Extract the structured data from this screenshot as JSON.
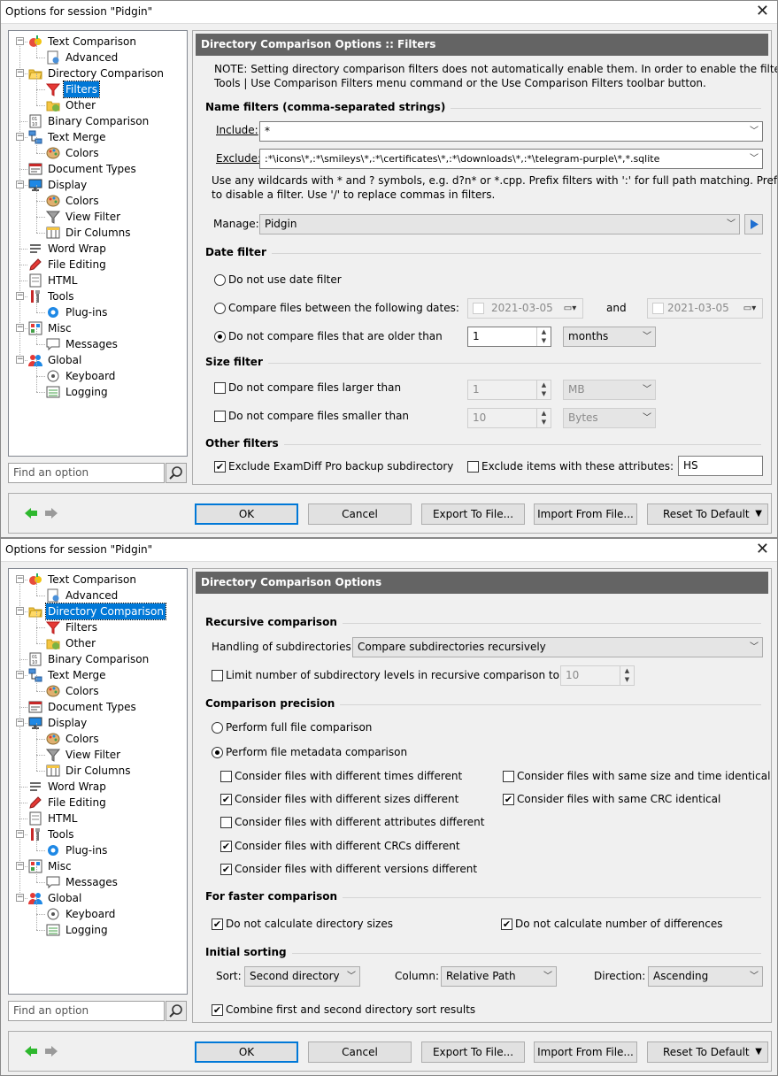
{
  "dialog1": {
    "title": "Options for session \"Pidgin\"",
    "tree": [
      {
        "label": "Text Comparison",
        "level": 0,
        "icon": "text-comparison-icon"
      },
      {
        "label": "Advanced",
        "level": 1,
        "icon": "advanced-icon"
      },
      {
        "label": "Directory Comparison",
        "level": 0,
        "icon": "folder-icon"
      },
      {
        "label": "Filters",
        "level": 1,
        "icon": "filter-icon",
        "selected": true
      },
      {
        "label": "Other",
        "level": 1,
        "icon": "other-folder-icon"
      },
      {
        "label": "Binary Comparison",
        "level": 0,
        "icon": "binary-icon"
      },
      {
        "label": "Text Merge",
        "level": 0,
        "icon": "merge-icon"
      },
      {
        "label": "Colors",
        "level": 1,
        "icon": "palette-icon"
      },
      {
        "label": "Document Types",
        "level": 0,
        "icon": "document-types-icon"
      },
      {
        "label": "Display",
        "level": 0,
        "icon": "monitor-icon"
      },
      {
        "label": "Colors",
        "level": 1,
        "icon": "palette-icon"
      },
      {
        "label": "View Filter",
        "level": 1,
        "icon": "funnel-icon"
      },
      {
        "label": "Dir Columns",
        "level": 1,
        "icon": "columns-icon"
      },
      {
        "label": "Word Wrap",
        "level": 0,
        "icon": "word-wrap-icon"
      },
      {
        "label": "File Editing",
        "level": 0,
        "icon": "pencil-icon"
      },
      {
        "label": "HTML",
        "level": 0,
        "icon": "html-icon"
      },
      {
        "label": "Tools",
        "level": 0,
        "icon": "tools-icon"
      },
      {
        "label": "Plug-ins",
        "level": 1,
        "icon": "plugin-icon"
      },
      {
        "label": "Misc",
        "level": 0,
        "icon": "misc-icon"
      },
      {
        "label": "Messages",
        "level": 1,
        "icon": "message-icon"
      },
      {
        "label": "Global",
        "level": 0,
        "icon": "users-icon"
      },
      {
        "label": "Keyboard",
        "level": 1,
        "icon": "keyboard-icon"
      },
      {
        "label": "Logging",
        "level": 1,
        "icon": "log-icon"
      }
    ],
    "find_placeholder": "Find an option",
    "header": "Directory Comparison Options :: Filters",
    "note_line1": "NOTE: Setting directory comparison filters does not automatically enable them. In order to enable the filters, use the",
    "note_line2": "Tools | Use Comparison Filters menu command or the Use Comparison Filters toolbar button.",
    "name_filters": "Name filters (comma-separated strings)",
    "include_label": "Include:",
    "include_value": "*",
    "exclude_label": "Exclude:",
    "exclude_value": ":*\\icons\\*,:*\\smileys\\*,:*\\certificates\\*,:*\\downloads\\*,:*\\telegram-purple\\*,*.sqlite",
    "wild_line1": "Use any wildcards with * and ? symbols, e.g. d?n* or *.cpp. Prefix filters with ':' for full path matching. Prefix with '|'",
    "wild_line2": "to disable a filter. Use '/' to replace commas in filters.",
    "manage_label": "Manage:",
    "manage_value": "Pidgin",
    "date_filter": "Date filter",
    "date_opt1": "Do not use date filter",
    "date_opt2": "Compare files between the following dates:",
    "date_from": "2021-03-05",
    "date_and": "and",
    "date_to": "2021-03-05",
    "date_opt3": "Do not compare files that are older than",
    "older_value": "1",
    "older_unit": "months",
    "size_filter": "Size filter",
    "size_opt1": "Do not compare files larger than",
    "larger_value": "1",
    "larger_unit": "MB",
    "size_opt2": "Do not compare files smaller than",
    "smaller_value": "10",
    "smaller_unit": "Bytes",
    "other_filters": "Other filters",
    "exclude_backup": "Exclude ExamDiff Pro backup subdirectory",
    "exclude_attrs": "Exclude items with these attributes:",
    "attrs_value": "HS"
  },
  "dialog2": {
    "title": "Options for session \"Pidgin\"",
    "header": "Directory Comparison Options",
    "recursive": "Recursive comparison",
    "handling_label": "Handling of subdirectories:",
    "handling_value": "Compare subdirectories recursively",
    "limit_label": "Limit number of subdirectory levels in recursive comparison to",
    "limit_value": "10",
    "precision": "Comparison precision",
    "full_cmp": "Perform full file comparison",
    "meta_cmp": "Perform file metadata comparison",
    "opt_times": "Consider files with different times different",
    "opt_sizes": "Consider files with different sizes different",
    "opt_attrs": "Consider files with different attributes different",
    "opt_crcs": "Consider files with different CRCs different",
    "opt_versions": "Consider files with different versions different",
    "opt_same_size_time": "Consider files with same size and time identical",
    "opt_same_crc": "Consider files with same CRC identical",
    "faster": "For faster comparison",
    "no_dir_sizes": "Do not calculate directory sizes",
    "no_num_diffs": "Do not calculate number of differences",
    "initial_sorting": "Initial sorting",
    "sort_label": "Sort:",
    "sort_value": "Second directory",
    "column_label": "Column:",
    "column_value": "Relative Path",
    "direction_label": "Direction:",
    "direction_value": "Ascending",
    "combine": "Combine first and second directory sort results"
  },
  "buttons": {
    "ok": "OK",
    "cancel": "Cancel",
    "export": "Export To File...",
    "import": "Import From File...",
    "reset": "Reset To Default"
  },
  "colors": {
    "accent": "#0078d7",
    "header": "#646464",
    "back_arrow": "#2eb82e",
    "fwd_arrow": "#9a9a9a"
  }
}
